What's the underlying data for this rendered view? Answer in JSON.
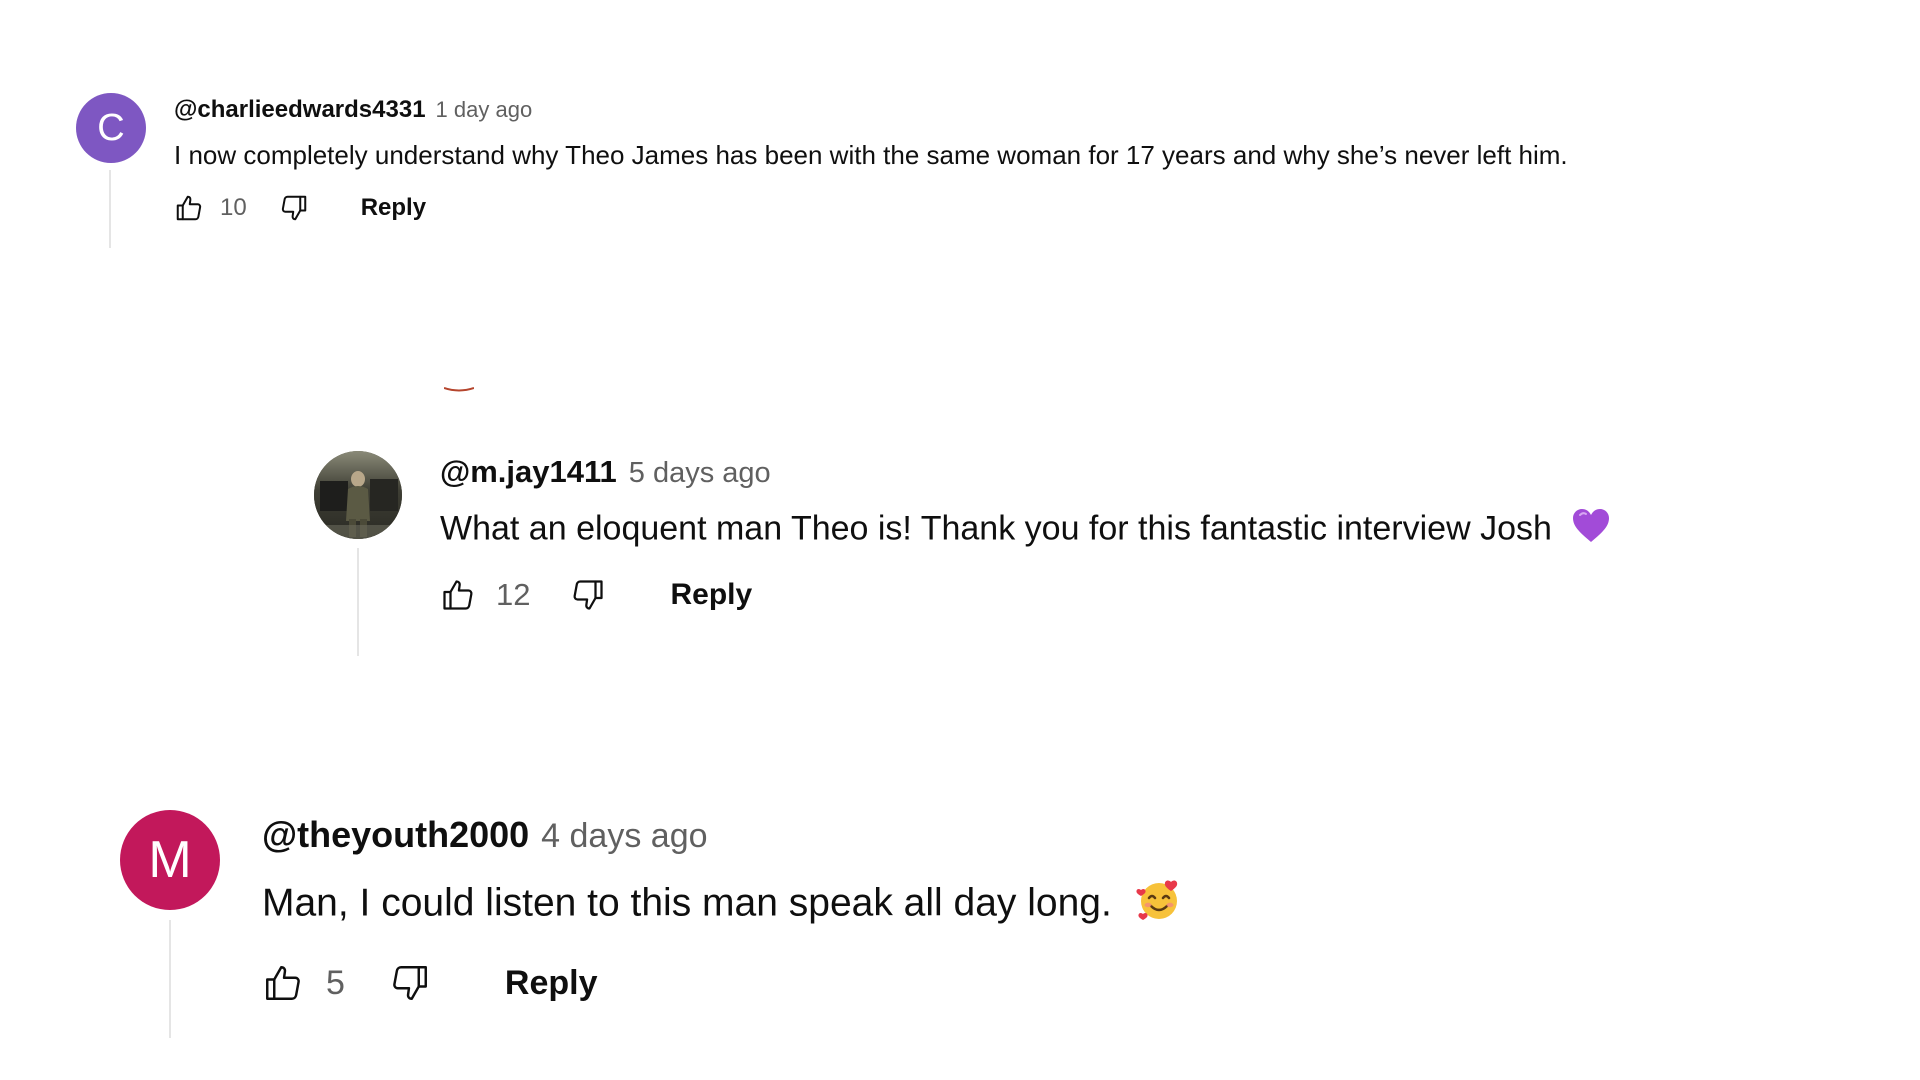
{
  "comments": [
    {
      "avatar_letter": "C",
      "avatar_color": "#7e57c2",
      "handle": "@charlieedwards4331",
      "time": "1 day ago",
      "text": "I now completely understand why Theo James has been with the same woman for 17 years and why she’s never left him.",
      "emoji": "",
      "likes": "10",
      "reply_label": "Reply"
    },
    {
      "avatar_letter": "",
      "avatar_color": "#4a4a3a",
      "handle": "@m.jay1411",
      "time": "5 days ago",
      "text": "What an eloquent man Theo is! Thank you for this fantastic interview Josh",
      "emoji": "purple-heart",
      "likes": "12",
      "reply_label": "Reply"
    },
    {
      "avatar_letter": "M",
      "avatar_color": "#c2185b",
      "handle": "@theyouth2000",
      "time": "4 days ago",
      "text": "Man, I could listen to this man speak all day long.",
      "emoji": "smiling-face-with-hearts",
      "likes": "5",
      "reply_label": "Reply"
    }
  ],
  "colors": {
    "text_primary": "#0f0f0f",
    "text_secondary": "#606060",
    "thread_line": "#e5e5e5"
  }
}
